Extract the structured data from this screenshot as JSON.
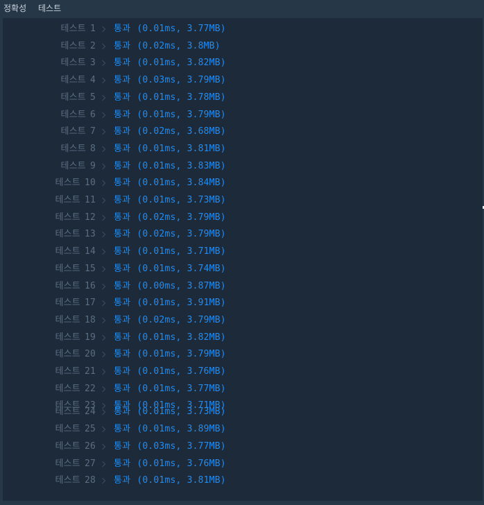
{
  "tabs": [
    {
      "label": "정확성"
    },
    {
      "label": "테스트"
    }
  ],
  "results": [
    {
      "label": "테스트",
      "num": "1",
      "status": "통과",
      "detail": "(0.01ms, 3.77MB)"
    },
    {
      "label": "테스트",
      "num": "2",
      "status": "통과",
      "detail": "(0.02ms, 3.8MB)"
    },
    {
      "label": "테스트",
      "num": "3",
      "status": "통과",
      "detail": "(0.01ms, 3.82MB)"
    },
    {
      "label": "테스트",
      "num": "4",
      "status": "통과",
      "detail": "(0.03ms, 3.79MB)"
    },
    {
      "label": "테스트",
      "num": "5",
      "status": "통과",
      "detail": "(0.01ms, 3.78MB)"
    },
    {
      "label": "테스트",
      "num": "6",
      "status": "통과",
      "detail": "(0.01ms, 3.79MB)"
    },
    {
      "label": "테스트",
      "num": "7",
      "status": "통과",
      "detail": "(0.02ms, 3.68MB)"
    },
    {
      "label": "테스트",
      "num": "8",
      "status": "통과",
      "detail": "(0.01ms, 3.81MB)"
    },
    {
      "label": "테스트",
      "num": "9",
      "status": "통과",
      "detail": "(0.01ms, 3.83MB)"
    },
    {
      "label": "테스트",
      "num": "10",
      "status": "통과",
      "detail": "(0.01ms, 3.84MB)"
    },
    {
      "label": "테스트",
      "num": "11",
      "status": "통과",
      "detail": "(0.01ms, 3.73MB)"
    },
    {
      "label": "테스트",
      "num": "12",
      "status": "통과",
      "detail": "(0.02ms, 3.79MB)"
    },
    {
      "label": "테스트",
      "num": "13",
      "status": "통과",
      "detail": "(0.02ms, 3.79MB)"
    },
    {
      "label": "테스트",
      "num": "14",
      "status": "통과",
      "detail": "(0.01ms, 3.71MB)"
    },
    {
      "label": "테스트",
      "num": "15",
      "status": "통과",
      "detail": "(0.01ms, 3.74MB)"
    },
    {
      "label": "테스트",
      "num": "16",
      "status": "통과",
      "detail": "(0.00ms, 3.87MB)"
    },
    {
      "label": "테스트",
      "num": "17",
      "status": "통과",
      "detail": "(0.01ms, 3.91MB)"
    },
    {
      "label": "테스트",
      "num": "18",
      "status": "통과",
      "detail": "(0.02ms, 3.79MB)"
    },
    {
      "label": "테스트",
      "num": "19",
      "status": "통과",
      "detail": "(0.01ms, 3.82MB)"
    },
    {
      "label": "테스트",
      "num": "20",
      "status": "통과",
      "detail": "(0.01ms, 3.79MB)"
    },
    {
      "label": "테스트",
      "num": "21",
      "status": "통과",
      "detail": "(0.01ms, 3.76MB)"
    },
    {
      "label": "테스트",
      "num": "22",
      "status": "통과",
      "detail": "(0.01ms, 3.77MB)"
    },
    {
      "label": "테스트",
      "num": "23",
      "status": "통과",
      "detail": "(0.01ms, 3.71MB)"
    },
    {
      "label": "테스트",
      "num": "24",
      "status": "통과",
      "detail": "(0.01ms, 3.73MB)"
    },
    {
      "label": "테스트",
      "num": "25",
      "status": "통과",
      "detail": "(0.01ms, 3.89MB)"
    },
    {
      "label": "테스트",
      "num": "26",
      "status": "통과",
      "detail": "(0.03ms, 3.77MB)"
    },
    {
      "label": "테스트",
      "num": "27",
      "status": "통과",
      "detail": "(0.01ms, 3.76MB)"
    },
    {
      "label": "테스트",
      "num": "28",
      "status": "통과",
      "detail": "(0.01ms, 3.81MB)"
    }
  ],
  "colors": {
    "background": "#263747",
    "panel": "#1c2a3a",
    "label": "#5b6e82",
    "pass": "#1f8ef7"
  }
}
